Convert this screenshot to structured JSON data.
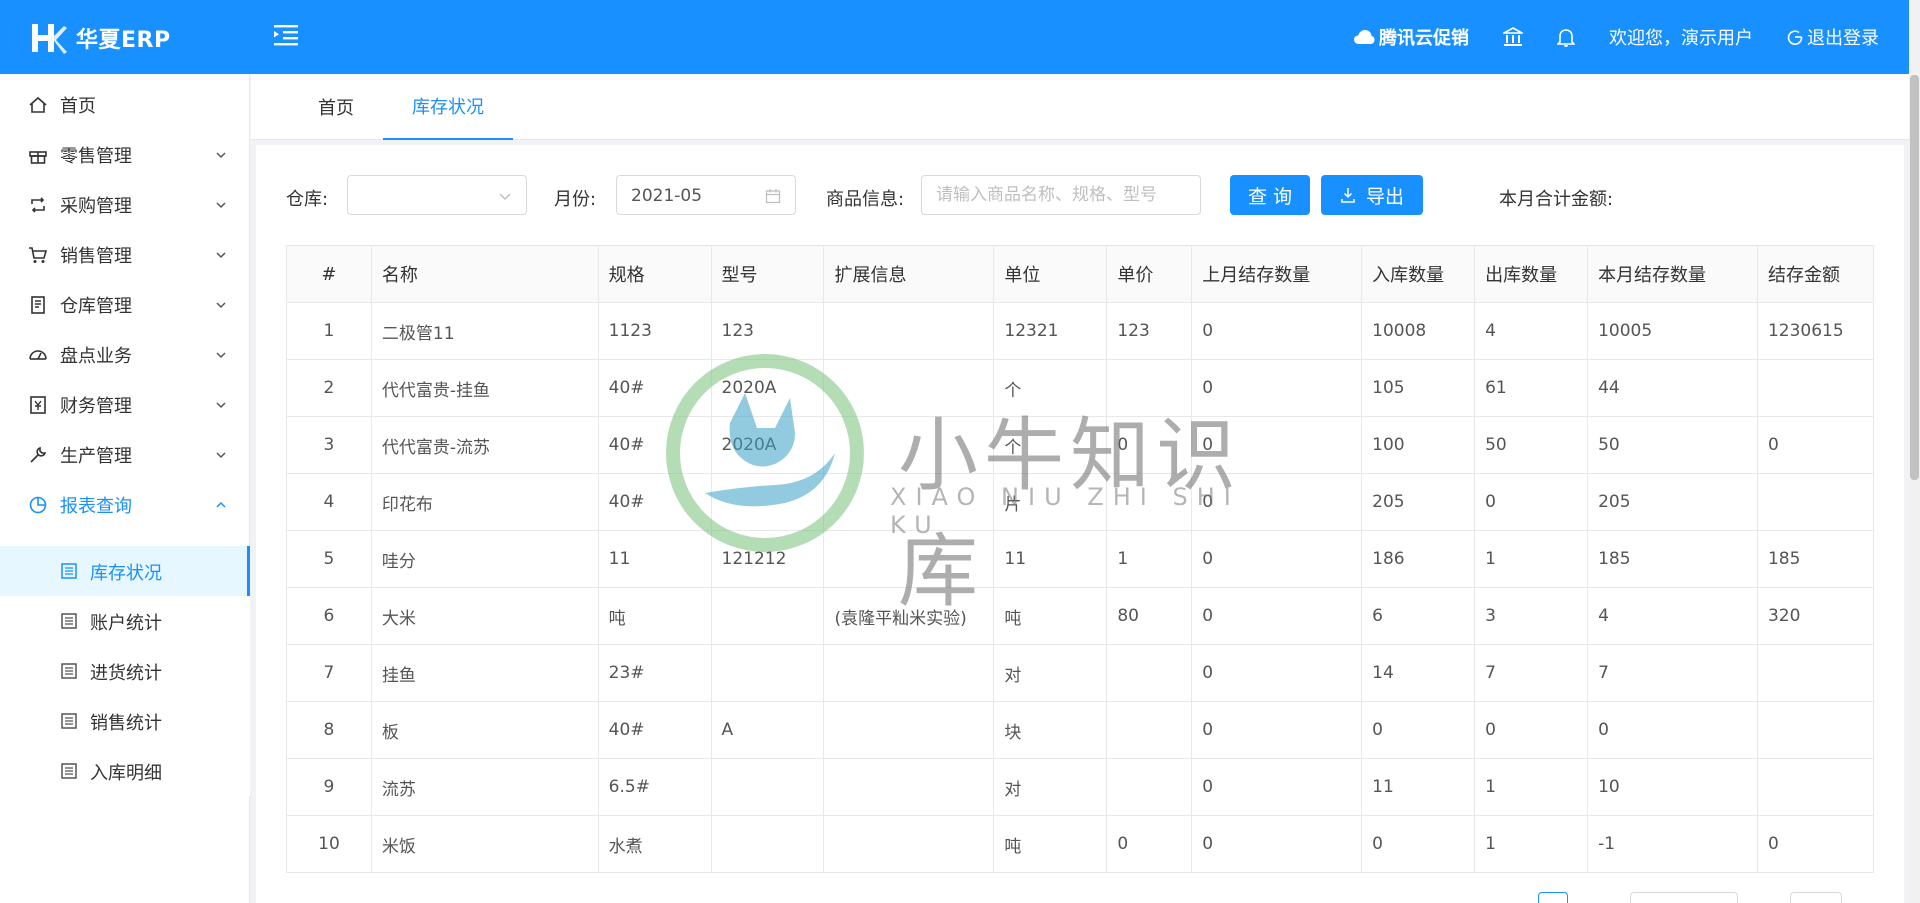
{
  "app": {
    "brand": "华夏ERP",
    "brand_color": "#1890ff"
  },
  "header": {
    "promo": "腾讯云促销",
    "bank_icon": "bank-icon",
    "bell_icon": "bell-icon",
    "welcome": "欢迎您，演示用户",
    "logout": "退出登录"
  },
  "sidebar": {
    "items": [
      {
        "label": "首页",
        "icon": "home-icon"
      },
      {
        "label": "零售管理",
        "icon": "gift-icon"
      },
      {
        "label": "采购管理",
        "icon": "retweet-icon"
      },
      {
        "label": "销售管理",
        "icon": "cart-icon"
      },
      {
        "label": "仓库管理",
        "icon": "book-icon"
      },
      {
        "label": "盘点业务",
        "icon": "dashboard-icon"
      },
      {
        "label": "财务管理",
        "icon": "money-icon"
      },
      {
        "label": "生产管理",
        "icon": "tool-icon"
      },
      {
        "label": "报表查询",
        "icon": "pie-chart-icon"
      }
    ],
    "sub_items": [
      {
        "label": "库存状况"
      },
      {
        "label": "账户统计"
      },
      {
        "label": "进货统计"
      },
      {
        "label": "销售统计"
      },
      {
        "label": "入库明细"
      }
    ]
  },
  "tabs": [
    {
      "label": "首页"
    },
    {
      "label": "库存状况"
    }
  ],
  "filters": {
    "warehouse_label": "仓库:",
    "warehouse_value": "",
    "month_label": "月份:",
    "month_value": "2021-05",
    "goods_label": "商品信息:",
    "goods_placeholder": "请输入商品名称、规格、型号",
    "query_button": "查 询",
    "export_button": "导出",
    "total_label": "本月合计金额:"
  },
  "table": {
    "columns": [
      "#",
      "名称",
      "规格",
      "型号",
      "扩展信息",
      "单位",
      "单价",
      "上月结存数量",
      "入库数量",
      "出库数量",
      "本月结存数量",
      "结存金额"
    ],
    "rows": [
      [
        "1",
        "二极管11",
        "1123",
        "123",
        "",
        "12321",
        "123",
        "0",
        "10008",
        "4",
        "10005",
        "1230615"
      ],
      [
        "2",
        "代代富贵-挂鱼",
        "40#",
        "2020A",
        "",
        "个",
        "",
        "0",
        "105",
        "61",
        "44",
        ""
      ],
      [
        "3",
        "代代富贵-流苏",
        "40#",
        "2020A",
        "",
        "个",
        "0",
        "0",
        "100",
        "50",
        "50",
        "0"
      ],
      [
        "4",
        "印花布",
        "40#",
        "",
        "",
        "片",
        "",
        "0",
        "205",
        "0",
        "205",
        ""
      ],
      [
        "5",
        "哇分",
        "11",
        "121212",
        "",
        "11",
        "1",
        "0",
        "186",
        "1",
        "185",
        "185"
      ],
      [
        "6",
        "大米",
        "吨",
        "",
        "(袁隆平籼米实验)",
        "吨",
        "80",
        "0",
        "6",
        "3",
        "4",
        "320"
      ],
      [
        "7",
        "挂鱼",
        "23#",
        "",
        "",
        "对",
        "",
        "0",
        "14",
        "7",
        "7",
        ""
      ],
      [
        "8",
        "板",
        "40#",
        "A",
        "",
        "块",
        "",
        "0",
        "0",
        "0",
        "0",
        ""
      ],
      [
        "9",
        "流苏",
        "6.5#",
        "",
        "",
        "对",
        "",
        "0",
        "11",
        "1",
        "10",
        ""
      ],
      [
        "10",
        "米饭",
        "水煮",
        "",
        "",
        "吨",
        "0",
        "0",
        "0",
        "1",
        "-1",
        "0"
      ]
    ]
  },
  "watermark": {
    "title": "小牛知识库",
    "subtitle": "XIAO NIU ZHI SHI KU"
  }
}
